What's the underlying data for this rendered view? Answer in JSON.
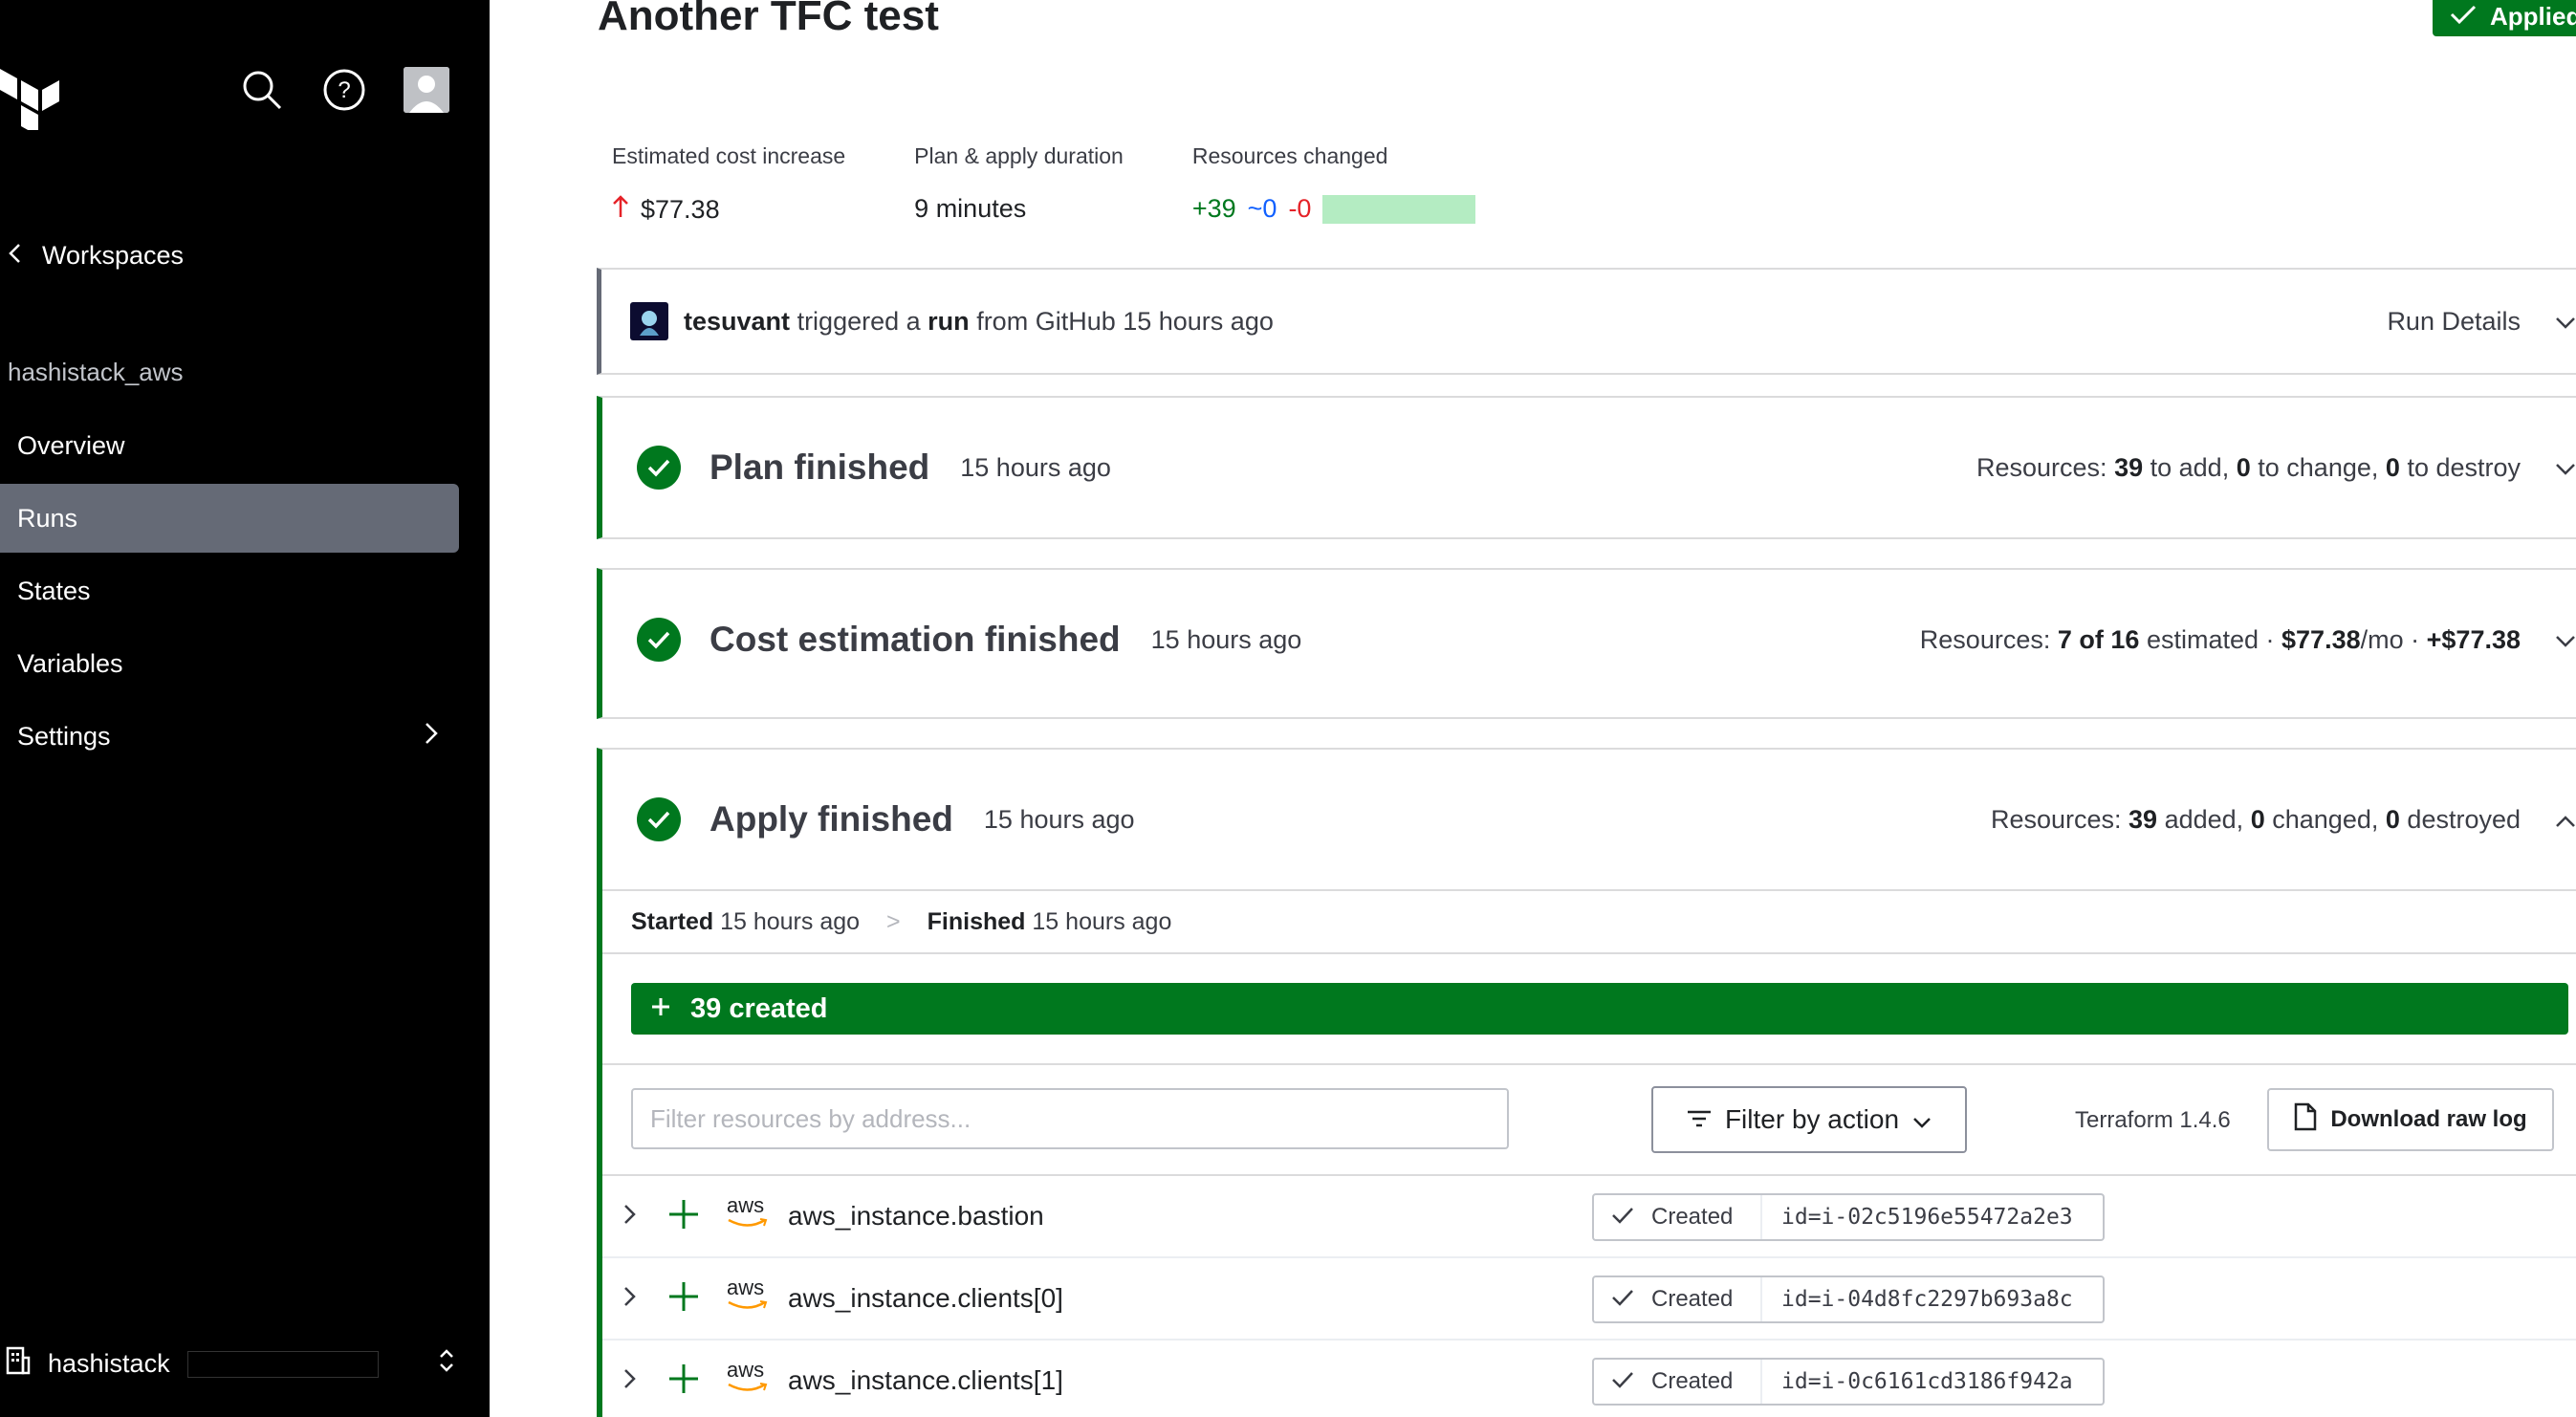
{
  "sidebar": {
    "back_label": "Workspaces",
    "org_name": "hashistack_aws",
    "nav": [
      {
        "label": "Overview",
        "active": false,
        "has_arrow": false
      },
      {
        "label": "Runs",
        "active": true,
        "has_arrow": false
      },
      {
        "label": "States",
        "active": false,
        "has_arrow": false
      },
      {
        "label": "Variables",
        "active": false,
        "has_arrow": false
      },
      {
        "label": "Settings",
        "active": false,
        "has_arrow": true
      }
    ],
    "footer_org": "hashistack"
  },
  "header": {
    "title": "Another TFC test",
    "status": "Applied"
  },
  "metrics": {
    "cost_label": "Estimated cost increase",
    "cost_value": "$77.38",
    "duration_label": "Plan & apply duration",
    "duration_value": "9 minutes",
    "changed_label": "Resources changed",
    "added": "+39",
    "changed": "~0",
    "destroyed": "-0"
  },
  "trigger": {
    "user": "tesuvant",
    "text_1": "triggered a",
    "run": "run",
    "text_2": "from GitHub 15 hours ago",
    "details": "Run Details"
  },
  "plan": {
    "title": "Plan finished",
    "time": "15 hours ago",
    "res_label": "Resources:",
    "add": "39",
    "add_label": "to add,",
    "change": "0",
    "change_label": "to change,",
    "destroy": "0",
    "destroy_label": "to destroy"
  },
  "cost": {
    "title": "Cost estimation finished",
    "time": "15 hours ago",
    "res_label": "Resources:",
    "estimated": "7 of 16",
    "estimated_label": "estimated ·",
    "monthly": "$77.38",
    "monthly_suffix": "/mo ·",
    "delta": "+$77.38"
  },
  "apply": {
    "title": "Apply finished",
    "time": "15 hours ago",
    "res_label": "Resources:",
    "added": "39",
    "added_label": "added,",
    "changed": "0",
    "changed_label": "changed,",
    "destroyed": "0",
    "destroyed_label": "destroyed",
    "started_label": "Started",
    "started_time": "15 hours ago",
    "sep": ">",
    "finished_label": "Finished",
    "finished_time": "15 hours ago",
    "created_count": "39 created",
    "filter_placeholder": "Filter resources by address...",
    "filter_action": "Filter by action",
    "tf_version": "Terraform 1.4.6",
    "download": "Download raw log"
  },
  "resources": [
    {
      "provider": "aws",
      "name": "aws_instance.bastion",
      "status": "Created",
      "id": "id=i-02c5196e55472a2e3"
    },
    {
      "provider": "aws",
      "name": "aws_instance.clients[0]",
      "status": "Created",
      "id": "id=i-04d8fc2297b693a8c"
    },
    {
      "provider": "aws",
      "name": "aws_instance.clients[1]",
      "status": "Created",
      "id": "id=i-0c6161cd3186f942a"
    }
  ],
  "colors": {
    "success": "#00781e",
    "sidebar_bg": "#000000",
    "active_nav": "#656a76",
    "added": "#00781e",
    "changed": "#1060ff",
    "destroyed": "#e52228"
  }
}
